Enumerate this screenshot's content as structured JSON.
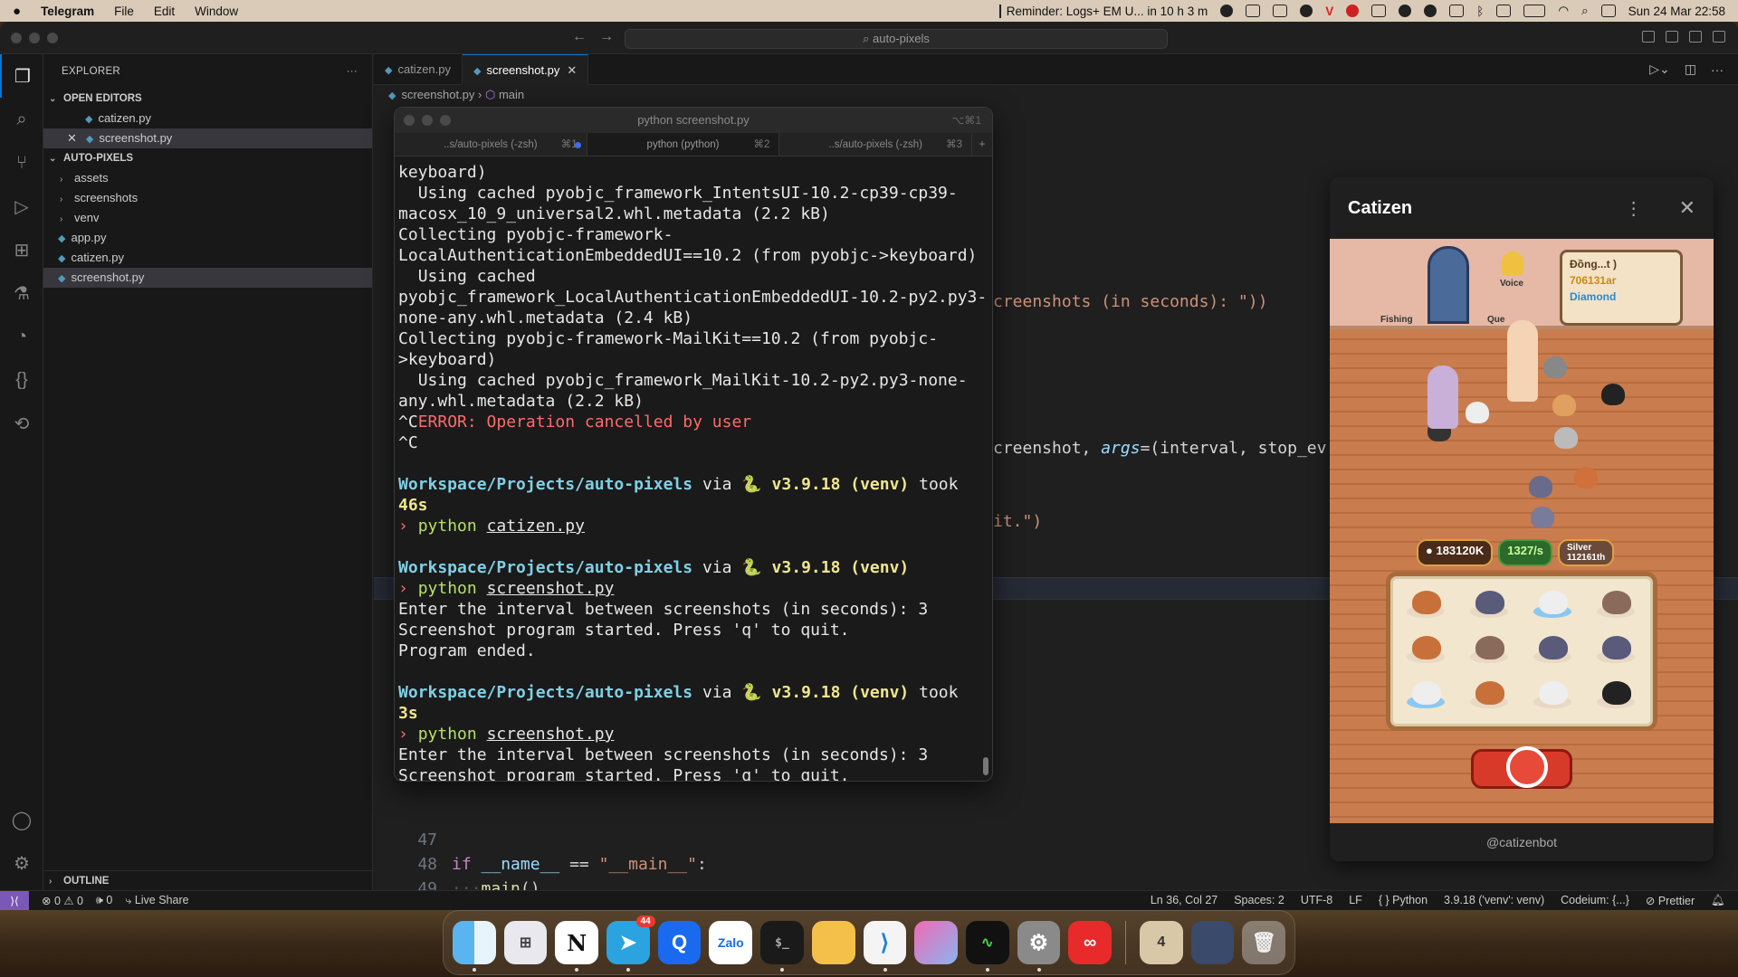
{
  "menubar": {
    "apple": "",
    "app": "Telegram",
    "menus": [
      "File",
      "Edit",
      "Window"
    ],
    "reminder": "Reminder: Logs+ EM U... in 10 h 3 m",
    "datetime": "Sun 24 Mar  22:58"
  },
  "vscode": {
    "command_center": "auto-pixels",
    "sidebar": {
      "title": "EXPLORER",
      "open_editors_label": "OPEN EDITORS",
      "open_editors": [
        "catizen.py",
        "screenshot.py"
      ],
      "project_label": "AUTO-PIXELS",
      "folders": [
        "assets",
        "screenshots",
        "venv"
      ],
      "files": [
        "app.py",
        "catizen.py",
        "screenshot.py"
      ],
      "outline_label": "OUTLINE"
    },
    "tabs": [
      {
        "label": "catizen.py",
        "active": false
      },
      {
        "label": "screenshot.py",
        "active": true
      }
    ],
    "breadcrumb": {
      "file": "screenshot.py",
      "symbol": "main"
    },
    "code_fragments": {
      "line_a": "creenshots (in seconds): \"))",
      "line_b_pre": "creenshot, ",
      "line_b_kw": "args",
      "line_b_post": "=(interval, stop_ev",
      "line_c": "it.\")"
    },
    "code_lines": [
      {
        "num": "47",
        "text": ""
      },
      {
        "num": "48",
        "text": "if __name__ == \"__main__\":"
      },
      {
        "num": "49",
        "text": "    main()"
      }
    ],
    "statusbar": {
      "problems": "⊗ 0 ⚠ 0",
      "ports": "🕪 0",
      "live_share": "Live Share",
      "cursor": "Ln 36, Col 27",
      "spaces": "Spaces: 2",
      "encoding": "UTF-8",
      "eol": "LF",
      "language": "Python",
      "interpreter": "3.9.18 ('venv': venv)",
      "codeium": "Codeium: {...}",
      "prettier": "Prettier"
    }
  },
  "terminal": {
    "title": "python screenshot.py",
    "title_shortcut": "⌥⌘1",
    "tabs": [
      {
        "label": "..s/auto-pixels (-zsh)",
        "shortcut": "⌘1"
      },
      {
        "label": "python (python)",
        "shortcut": "⌘2"
      },
      {
        "label": "..s/auto-pixels (-zsh)",
        "shortcut": "⌘3"
      }
    ],
    "plus": "+",
    "lines": [
      "keyboard)",
      "  Using cached pyobjc_framework_IntentsUI-10.2-cp39-cp39-macosx_10_9_universal2.whl.metadata (2.2 kB)",
      "Collecting pyobjc-framework-LocalAuthenticationEmbeddedUI==10.2 (from pyobjc->keyboard)",
      "  Using cached pyobjc_framework_LocalAuthenticationEmbeddedUI-10.2-py2.py3-none-any.whl.metadata (2.4 kB)",
      "Collecting pyobjc-framework-MailKit==10.2 (from pyobjc->keyboard)",
      "  Using cached pyobjc_framework_MailKit-10.2-py2.py3-none-any.whl.metadata (2.2 kB)"
    ],
    "error_prefix": "^C",
    "error_text": "ERROR: Operation cancelled by user",
    "ctrl_c": "^C",
    "prompt_path": "Workspace/Projects/auto-pixels",
    "prompt_via": " via ",
    "prompt_snake": "🐍",
    "prompt_version": " v3.9.18 (venv)",
    "prompt_took": " took",
    "took_1": "46s",
    "took_2": "3s",
    "arrow": "›",
    "cmd_python": "python",
    "cmd_file_1": "catizen.py",
    "cmd_file_2": "screenshot.py",
    "out_enter": "Enter the interval between screenshots (in seconds): 3",
    "out_started": "Screenshot program started. Press 'q' to quit.",
    "out_ended": "Program ended."
  },
  "catizen": {
    "title": "Catizen",
    "shop_title": "Đồng...t )",
    "gold": "706131ar",
    "diamond": "Diamond",
    "labels": {
      "fishing": "Fishing",
      "voice": "Voice",
      "quest": "Que"
    },
    "coins": "183120K",
    "rate": "1327/s",
    "rank_1": "Silver",
    "rank_2": "112161th",
    "footer": "@catizenbot"
  },
  "dock": {
    "telegram_badge": "44",
    "apps": [
      "Finder",
      "Launchpad",
      "Notion",
      "Telegram",
      "Qwant",
      "Zalo",
      "Terminal",
      "Folder",
      "VS Code",
      "Pixelmator",
      "Activity Monitor",
      "System Settings",
      "Acrobat",
      "Stack",
      "Screenshots",
      "Trash"
    ]
  },
  "colors": {
    "accent": "#0078d4",
    "remote": "#7b57b8",
    "error": "#ff6a6a"
  }
}
